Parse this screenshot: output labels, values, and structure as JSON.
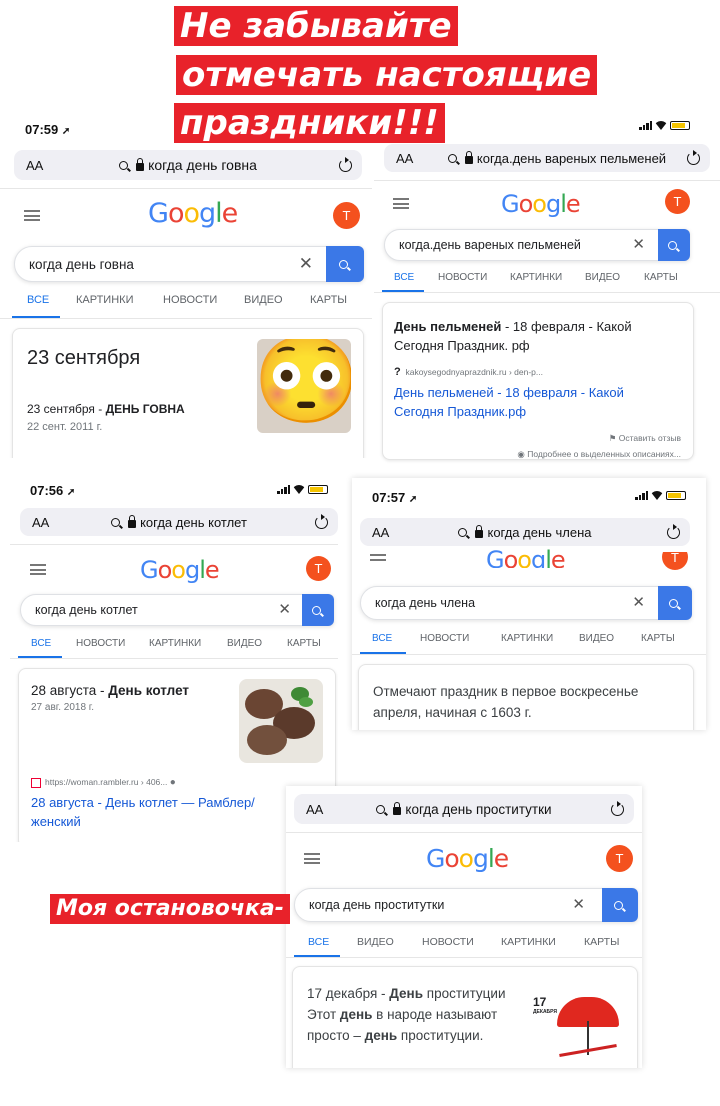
{
  "header": {
    "line1": "Не забывайте",
    "line2": "отмечать настоящие",
    "line3": "праздники!!!"
  },
  "side_caption": "Моя остановочка-",
  "ui": {
    "aa": "AA",
    "tabs1": [
      "ВСЕ",
      "КАРТИНКИ",
      "НОВОСТИ",
      "ВИДЕО",
      "КАРТЫ"
    ],
    "tabs2": [
      "ВСЕ",
      "НОВОСТИ",
      "КАРТИНКИ",
      "ВИДЕО",
      "КАРТЫ"
    ],
    "tabs3": [
      "ВСЕ",
      "ВИДЕО",
      "НОВОСТИ",
      "КАРТИНКИ",
      "КАРТЫ"
    ],
    "avatar_letter": "T",
    "logo": [
      "G",
      "o",
      "o",
      "g",
      "l",
      "e"
    ]
  },
  "shot1": {
    "time": "07:59",
    "url": "когда день говна",
    "query": "когда день говна",
    "answer": "23 сентября",
    "snippet_date": "23 сентября - ",
    "snippet_bold": "ДЕНЬ ГОВНА",
    "snippet_sub": "22 сент. 2011 г.",
    "emoji": "😳"
  },
  "shot2": {
    "url": "когда.день вареных пельменей",
    "query": "когда.день вареных пельменей",
    "title_bold": "День пельменей",
    "title_rest": " - 18 февраля - Какой Сегодня Праздник. рф",
    "source": "kakoysegodnyaprazdnik.ru › den-p...",
    "link": "День пельменей - 18 февраля - Какой Сегодня Праздник.рф",
    "feedback": "Оставить отзыв",
    "more": "Подробнее о выделенных описаниях..."
  },
  "shot3": {
    "time": "07:56",
    "url": "когда день котлет",
    "query": "когда день котлет",
    "title_date": "28 августа - ",
    "title_bold": "День котлет",
    "sub": "27 авг. 2018 г.",
    "source": "https://woman.rambler.ru › 406...",
    "link": "28 августа - День котлет — Рамблер/женский"
  },
  "shot4": {
    "time": "07:57",
    "url": "когда день члена",
    "query": "когда день члена",
    "answer": "Отмечают праздник в первое воскресенье апреля, начиная с 1603 г."
  },
  "shot5": {
    "url": "когда день проститутки",
    "query": "когда день проститутки",
    "t1": "17 декабря - ",
    "t2": "День",
    "t3": "проституции Этот ",
    "t4": "день",
    "t5": " в народе называют просто – ",
    "t6": "день",
    "t7": " проституции.",
    "thumb_date": "17",
    "thumb_month": "ДЕКАБРЯ"
  },
  "colors": {
    "sticker": "#e8222a",
    "google_blue": "#4285f4",
    "google_red": "#ea4335",
    "google_yellow": "#fbbc05",
    "google_green": "#34a853",
    "avatar": "#f4511e",
    "link": "#1558d6"
  }
}
